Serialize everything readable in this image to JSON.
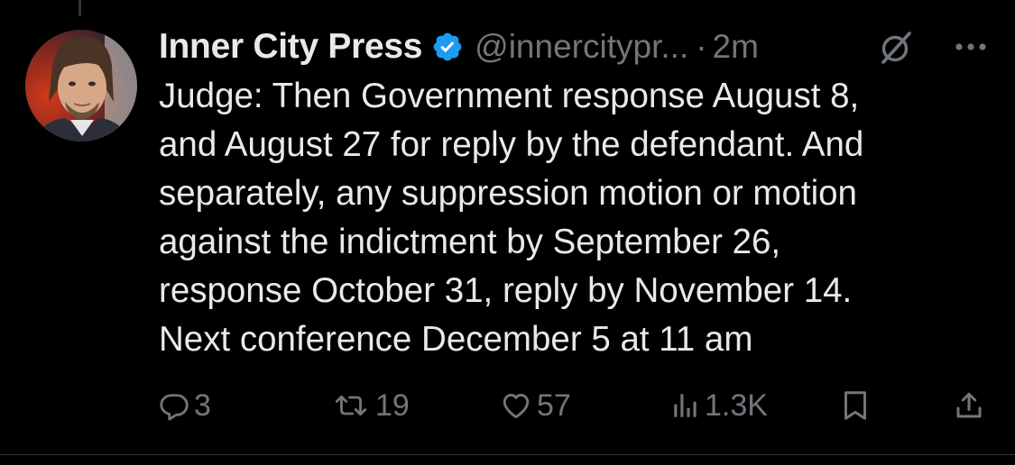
{
  "tweet": {
    "author": {
      "display_name": "Inner City Press",
      "handle": "@innercitypr...",
      "verified": true,
      "avatar_icon": "avatar-photo"
    },
    "separator": "·",
    "timestamp": "2m",
    "text_lines": [
      "Judge: Then Government response August 8,",
      "and August 27 for reply by the defendant. And",
      "separately, any suppression motion or motion",
      "against the indictment by September 26,",
      "response October 31, reply by November 14.",
      "Next conference December 5 at 11 am"
    ],
    "actions": {
      "replies": "3",
      "reposts": "19",
      "likes": "57",
      "views": "1.3K"
    }
  },
  "icons": {
    "verified": "verified-badge-icon",
    "grok": "grok-icon",
    "more": "more-options-icon",
    "reply": "reply-icon",
    "repost": "repost-icon",
    "like": "like-icon",
    "views": "views-icon",
    "bookmark": "bookmark-icon",
    "share": "share-icon"
  },
  "colors": {
    "background": "#000000",
    "text_primary": "#e7e9ea",
    "text_secondary": "#71767b",
    "verified_blue": "#1d9bf0",
    "divider": "#2f3336"
  }
}
